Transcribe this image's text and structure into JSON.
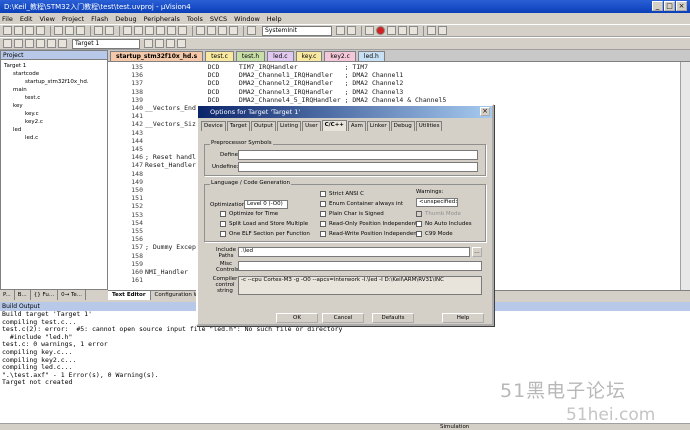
{
  "window": {
    "title": "D:\\Keil_教程\\STM32入门教程\\test\\test.uvproj - µVision4"
  },
  "menu": [
    "File",
    "Edit",
    "View",
    "Project",
    "Flash",
    "Debug",
    "Peripherals",
    "Tools",
    "SVCS",
    "Window",
    "Help"
  ],
  "toolbar": {
    "function_combo": "SystemInit",
    "target_combo": "Target 1"
  },
  "project_panel": {
    "title": "Project",
    "tree": [
      "Target 1",
      "startcode",
      "startup_stm32f10x_hd.",
      "main",
      "test.c",
      "key",
      "key.c",
      "key2.c",
      "led",
      "led.c"
    ],
    "tabs": [
      "P...",
      "B...",
      "{} Fu...",
      "0→ Te..."
    ]
  },
  "file_tabs": [
    "startup_stm32f10x_hd.s",
    "test.c",
    "test.h",
    "led.c",
    "key.c",
    "key2.c",
    "led.h"
  ],
  "editor": {
    "lines": [
      {
        "n": "135",
        "c": "                DCD     TIM7_IRQHandler            ; TIM7"
      },
      {
        "n": "136",
        "c": "                DCD     DMA2_Channel1_IRQHandler   ; DMA2 Channel1"
      },
      {
        "n": "137",
        "c": "                DCD     DMA2_Channel2_IRQHandler   ; DMA2 Channel2"
      },
      {
        "n": "138",
        "c": "                DCD     DMA2_Channel3_IRQHandler   ; DMA2 Channel3"
      },
      {
        "n": "139",
        "c": "                DCD     DMA2_Channel4_5_IRQHandler ; DMA2 Channel4 & Channel5"
      },
      {
        "n": "140",
        "c": "__Vectors_End"
      },
      {
        "n": "141",
        "c": ""
      },
      {
        "n": "142",
        "c": "__Vectors_Size"
      },
      {
        "n": "143",
        "c": ""
      },
      {
        "n": "144",
        "c": ""
      },
      {
        "n": "145",
        "c": ""
      },
      {
        "n": "146",
        "c": "; Reset handl"
      },
      {
        "n": "147",
        "c": "Reset_Handler"
      },
      {
        "n": "148",
        "c": ""
      },
      {
        "n": "149",
        "c": ""
      },
      {
        "n": "150",
        "c": ""
      },
      {
        "n": "151",
        "c": ""
      },
      {
        "n": "152",
        "c": ""
      },
      {
        "n": "153",
        "c": ""
      },
      {
        "n": "154",
        "c": ""
      },
      {
        "n": "155",
        "c": ""
      },
      {
        "n": "156",
        "c": ""
      },
      {
        "n": "157",
        "c": "; Dummy Excep"
      },
      {
        "n": "158",
        "c": ""
      },
      {
        "n": "159",
        "c": ""
      },
      {
        "n": "160",
        "c": "NMI_Handler"
      },
      {
        "n": "161",
        "c": ""
      }
    ],
    "bottom_tabs": [
      "Text Editor",
      "Configuration Wiz"
    ]
  },
  "dialog": {
    "title": "Options for Target 'Target 1'",
    "tabs": [
      "Device",
      "Target",
      "Output",
      "Listing",
      "User",
      "C/C++",
      "Asm",
      "Linker",
      "Debug",
      "Utilities"
    ],
    "active_tab": "C/C++",
    "preprocessor": {
      "group": "Preprocessor Symbols",
      "define_label": "Define:",
      "define_value": "",
      "undefine_label": "Undefine:",
      "undefine_value": ""
    },
    "language": {
      "group": "Language / Code Generation",
      "optimization_label": "Optimization:",
      "optimization_value": "Level 0 (-O0)",
      "checks": [
        "Optimize for Time",
        "Split Load and Store Multiple",
        "One ELF Section per Function",
        "Strict ANSI C",
        "Enum Container always int",
        "Plain Char is Signed",
        "Read-Only Position Independent",
        "Read-Write Position Independent"
      ],
      "warnings_label": "Warnings:",
      "warnings_value": "<unspecified>",
      "thumb_mode": "Thumb Mode",
      "no_auto_includes": "No Auto Includes",
      "c99_mode": "C99 Mode"
    },
    "include_label": "Include Paths",
    "include_value": ".\\led",
    "misc_label": "Misc Controls",
    "misc_value": "",
    "compiler_label": "Compiler control string",
    "compiler_value": "-c --cpu Cortex-M3 -g -O0 --apcs=interwork -I.\\led -I D:\\Keil\\ARM\\RV31\\INC",
    "buttons": [
      "OK",
      "Cancel",
      "Defaults",
      "Help"
    ]
  },
  "build_output": {
    "title": "Build Output",
    "lines": [
      "Build target 'Target 1'",
      "compiling test.c...",
      "test.c(2): error:  #5: cannot open source input file \"led.h\": No such file or directory",
      "  #include \"led.h\"",
      "test.c: 0 warnings, 1 error",
      "compiling key.c...",
      "compiling key2.c...",
      "compiling led.c...",
      "\".\\test.axf\" - 1 Error(s), 0 Warning(s).",
      "Target not created"
    ]
  },
  "status": {
    "mode": "Simulation"
  },
  "watermark": {
    "line1": "51黑电子论坛",
    "line2": "51hei.com"
  }
}
